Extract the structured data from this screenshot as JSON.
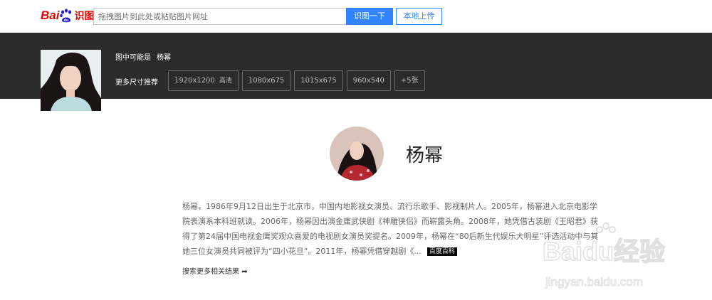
{
  "header": {
    "logo_text_bai": "Bai",
    "logo_text_du": "du",
    "logo_text_shitu": "识图",
    "search_placeholder": "拖拽图片到此处或粘贴图片网址",
    "search_button": "识图一下",
    "upload_button": "本地上传"
  },
  "result_band": {
    "maybe_label": "图中可能是",
    "maybe_name": "杨幂",
    "more_sizes_label": "更多尺寸推荐",
    "sizes": [
      {
        "label": "1920x1200",
        "tag": "高清"
      },
      {
        "label": "1080x675",
        "tag": ""
      },
      {
        "label": "1015x675",
        "tag": ""
      },
      {
        "label": "960x540",
        "tag": ""
      },
      {
        "label": "+5张",
        "tag": ""
      }
    ]
  },
  "main": {
    "person_name": "杨幂",
    "description": "杨幂，1986年9月12日出生于北京市，中国内地影视女演员、流行乐歌手、影视制片人。2005年，杨幂进入北京电影学院表演系本科班就读。2006年，杨幂因出演金庸武侠剧《神雕侠侣》而崭露头角。2008年，她凭借古装剧《王昭君》获得了第24届中国电视金鹰奖观众喜爱的电视剧女演员奖提名。2009年，杨幂在“80后新生代娱乐大明星”评选活动中与其她三位女演员共同被评为“四小花旦”。2011年，杨幂凭借穿越剧《...",
    "baike_badge": "百度百科",
    "more_results": "搜索更多相关结果",
    "more_results_arrow": "➡"
  },
  "watermark": {
    "brand": "Baidu经验",
    "url": "jingyan.baidu.com"
  },
  "colors": {
    "brand_red": "#e10602",
    "brand_blue": "#3385ff",
    "band_bg": "#2b2b2b"
  },
  "icons": {
    "logo_paw": "baidu-paw-icon",
    "arrow": "arrow-right-icon"
  }
}
